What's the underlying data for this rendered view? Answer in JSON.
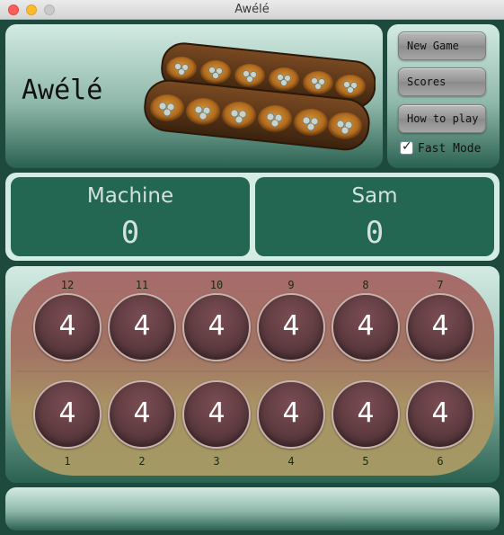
{
  "window": {
    "title": "Awélé"
  },
  "header": {
    "title": "Awélé"
  },
  "controls": {
    "new_game": "New Game",
    "scores": "Scores",
    "how_to_play": "How to play",
    "fast_mode": "Fast Mode",
    "fast_mode_checked": true
  },
  "scores": {
    "left_name": "Machine",
    "left_value": "0",
    "right_name": "Sam",
    "right_value": "0"
  },
  "board": {
    "top_row": [
      {
        "number": "12",
        "seeds": "4"
      },
      {
        "number": "11",
        "seeds": "4"
      },
      {
        "number": "10",
        "seeds": "4"
      },
      {
        "number": "9",
        "seeds": "4"
      },
      {
        "number": "8",
        "seeds": "4"
      },
      {
        "number": "7",
        "seeds": "4"
      }
    ],
    "bottom_row": [
      {
        "number": "1",
        "seeds": "4"
      },
      {
        "number": "2",
        "seeds": "4"
      },
      {
        "number": "3",
        "seeds": "4"
      },
      {
        "number": "4",
        "seeds": "4"
      },
      {
        "number": "5",
        "seeds": "4"
      },
      {
        "number": "6",
        "seeds": "4"
      }
    ]
  },
  "status": {
    "message": ""
  },
  "colors": {
    "window_bg": "#1d4a3c",
    "score_box": "#236652",
    "pit": "#5e3b40"
  }
}
